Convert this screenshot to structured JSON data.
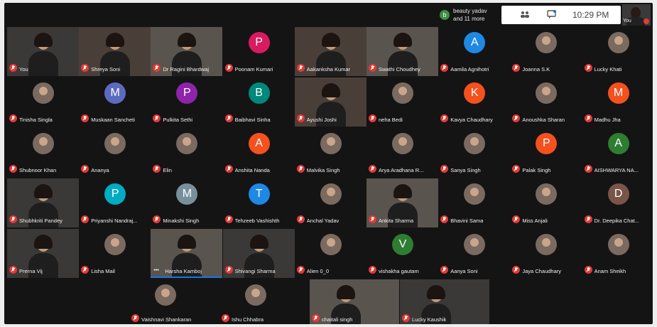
{
  "meeting": {
    "chat_preview": {
      "initial": "b",
      "name": "beauty yadav",
      "more": "and 11 more"
    },
    "clock": "10:29 PM",
    "self_view_label": "You"
  },
  "colors": {
    "muted": "#e53935",
    "speaking": "#1a73e8"
  },
  "participants": [
    {
      "name": "You",
      "type": "video"
    },
    {
      "name": "Shreya Soni",
      "type": "video"
    },
    {
      "name": "Dr Ragini Bhardwaj",
      "type": "video"
    },
    {
      "name": "Poonam Kumari",
      "type": "initial",
      "initial": "P",
      "color": "#d81b60"
    },
    {
      "name": "Aakanksha Kumar",
      "type": "video"
    },
    {
      "name": "Swathi Choudhey",
      "type": "video"
    },
    {
      "name": "Aamila Agnihotri",
      "type": "initial",
      "initial": "A",
      "color": "#1e88e5"
    },
    {
      "name": "Joanna S.K",
      "type": "photo"
    },
    {
      "name": "Lucky Khati",
      "type": "photo"
    },
    {
      "name": "Tinisha Singla",
      "type": "photo"
    },
    {
      "name": "Muskaan Sancheti",
      "type": "initial",
      "initial": "M",
      "color": "#5c6bc0"
    },
    {
      "name": "Pulkita Sethi",
      "type": "initial",
      "initial": "P",
      "color": "#8e24aa"
    },
    {
      "name": "Baibhavi Sinha",
      "type": "initial",
      "initial": "B",
      "color": "#00897b"
    },
    {
      "name": "Ayushi Joshi",
      "type": "video"
    },
    {
      "name": "neha Bedi",
      "type": "photo"
    },
    {
      "name": "Kavya Chaudhary",
      "type": "initial",
      "initial": "K",
      "color": "#f4511e"
    },
    {
      "name": "Anoushka Sharan",
      "type": "photo"
    },
    {
      "name": "Madhu Jha",
      "type": "initial",
      "initial": "M",
      "color": "#f4511e"
    },
    {
      "name": "Shubnoor Khan",
      "type": "photo"
    },
    {
      "name": "Ananya",
      "type": "photo"
    },
    {
      "name": "Elin",
      "type": "photo"
    },
    {
      "name": "Anshita Nanda",
      "type": "initial",
      "initial": "A",
      "color": "#f4511e"
    },
    {
      "name": "Malvika Singh",
      "type": "photo"
    },
    {
      "name": "Arya Aradhana R...",
      "type": "photo"
    },
    {
      "name": "Sanya Singh",
      "type": "photo"
    },
    {
      "name": "Palak Singh",
      "type": "initial",
      "initial": "P",
      "color": "#f4511e"
    },
    {
      "name": "AISHWARYA NA...",
      "type": "initial",
      "initial": "A",
      "color": "#2e7d32"
    },
    {
      "name": "Shubhkriti Pandey",
      "type": "video"
    },
    {
      "name": "Priyanshi Nandraj...",
      "type": "initial",
      "initial": "P",
      "color": "#00acc1"
    },
    {
      "name": "Minakshi Singh",
      "type": "initial",
      "initial": "M",
      "color": "#78909c"
    },
    {
      "name": "Tehzeeb Vashishth",
      "type": "initial",
      "initial": "T",
      "color": "#1e88e5"
    },
    {
      "name": "Anchal Yadav",
      "type": "photo"
    },
    {
      "name": "Ankita Sharma",
      "type": "video"
    },
    {
      "name": "Bhavini Sama",
      "type": "photo"
    },
    {
      "name": "Miss Anjali",
      "type": "photo"
    },
    {
      "name": "Dr. Deepika Chat...",
      "type": "initial",
      "initial": "D",
      "color": "#795548"
    },
    {
      "name": "Prerna Vij",
      "type": "video"
    },
    {
      "name": "Lisha Mail",
      "type": "photo"
    },
    {
      "name": "Harsha Kamboj",
      "type": "video",
      "speaking": true
    },
    {
      "name": "Shivangi Sharma",
      "type": "video"
    },
    {
      "name": "Alien 0_0",
      "type": "photo"
    },
    {
      "name": "vishakha gautam",
      "type": "initial",
      "initial": "V",
      "color": "#2e7d32"
    },
    {
      "name": "Aanya Soni",
      "type": "photo"
    },
    {
      "name": "Jaya Chaudhary",
      "type": "photo"
    },
    {
      "name": "Anam Sheikh",
      "type": "photo"
    },
    {
      "name": "Vaishnavi Shankaran",
      "type": "photo"
    },
    {
      "name": "Ishu Chhabra",
      "type": "photo"
    },
    {
      "name": "chaitali singh",
      "type": "video"
    },
    {
      "name": "Lucky Kaushik",
      "type": "video"
    }
  ]
}
